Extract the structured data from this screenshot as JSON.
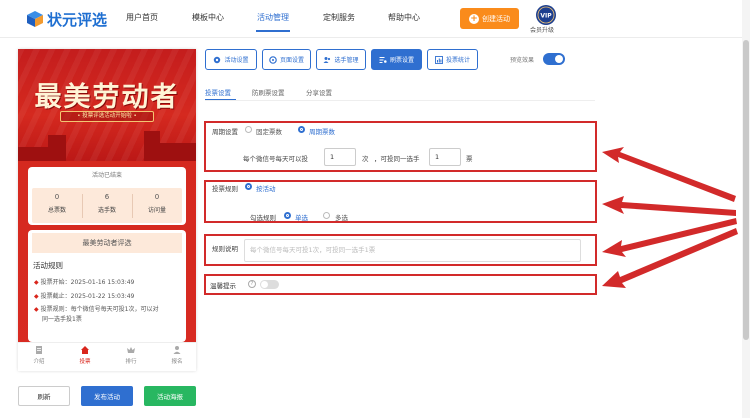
{
  "brand": {
    "name": "状元评选"
  },
  "nav": {
    "items": [
      "用户首页",
      "模板中心",
      "活动管理",
      "定制服务",
      "帮助中心"
    ],
    "active_index": 2,
    "create_label": "创建活动",
    "vip_badge": "VIP",
    "vip_label": "会员升级"
  },
  "preview": {
    "banner_title": "最美劳动者",
    "banner_ribbon": "• 投票评选活动开始啦 •",
    "status": "活动已结束",
    "stats": [
      {
        "value": "0",
        "label": "总票数"
      },
      {
        "value": "6",
        "label": "选手数"
      },
      {
        "value": "0",
        "label": "访问量"
      }
    ],
    "activity_name": "最美劳动者评选",
    "rules_title": "活动规则",
    "rules": [
      "投票开始：2025-01-16 15:03:49",
      "投票截止：2025-01-22 15:03:49",
      "投票规则：每个微信号每天可投1次，可以对",
      "同一选手投1票"
    ],
    "tabbar": [
      {
        "label": "介绍",
        "icon": "doc-icon"
      },
      {
        "label": "投票",
        "icon": "home-icon"
      },
      {
        "label": "排行",
        "icon": "crown-icon"
      },
      {
        "label": "报名",
        "icon": "user-icon"
      }
    ],
    "tabbar_active": 1
  },
  "buttons": {
    "refresh": "刷新",
    "publish": "发布活动",
    "poster": "活动海报"
  },
  "toolbar": {
    "items": [
      "活动设置",
      "页面设置",
      "选手管理",
      "刷票设置",
      "投票统计"
    ],
    "active_index": 3,
    "preview_label": "预览效果",
    "preview_on": true
  },
  "subtabs": {
    "items": [
      "投票设置",
      "防刷票设置",
      "分享设置"
    ],
    "active_index": 0
  },
  "form": {
    "cycle_label": "周期设置",
    "cycle_options": [
      "固定票数",
      "周期票数"
    ],
    "cycle_selected": 1,
    "per_day_prefix": "每个微信号每天可以投",
    "per_day_value": "1",
    "per_day_unit": "次",
    "same_prefix": "，可投同一选手",
    "same_value": "1",
    "same_unit": "票",
    "vote_rule_label": "投票规则",
    "vote_rule_option": "按活动",
    "check_label": "勾选规则",
    "check_options": [
      "单选",
      "多选"
    ],
    "check_selected": 0,
    "rules_label": "规则说明",
    "rules_placeholder": "每个微信号每天可投1次，可投同一选手1票",
    "tip_label": "温馨提示",
    "tip_help": "?",
    "tip_on": false
  },
  "colors": {
    "primary": "#2f6fd0",
    "accent": "#fa8b1b",
    "success": "#28b761",
    "highlight": "#d22a2a"
  }
}
